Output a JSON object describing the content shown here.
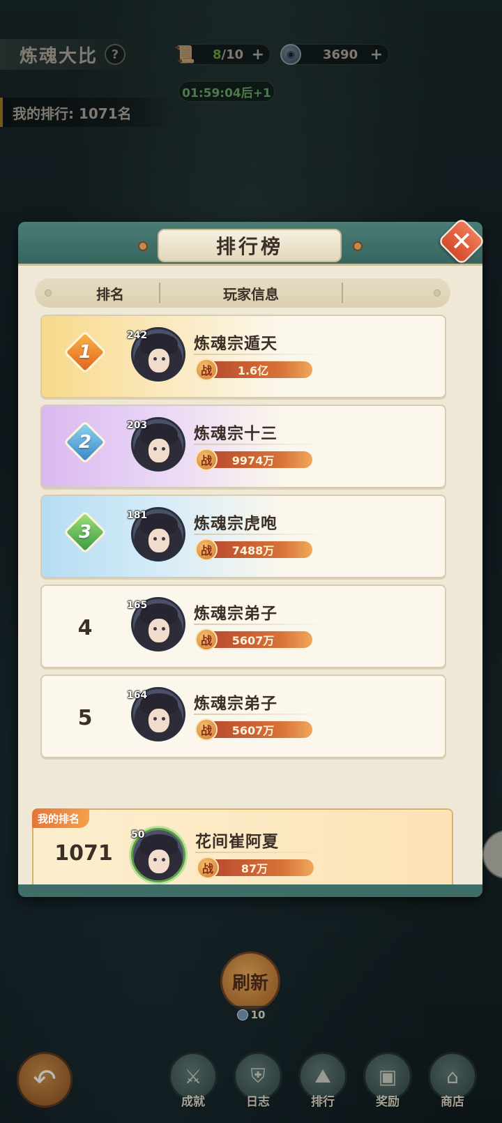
{
  "header": {
    "title": "炼魂大比",
    "help_icon": "question-icon",
    "stamina": {
      "icon": "stamina-icon",
      "current": "8",
      "total": "/10",
      "plus": "+"
    },
    "currency": {
      "icon": "coin-icon",
      "value": "3690",
      "plus": "+"
    },
    "timer": "01:59:04后+1",
    "my_rank_text": "我的排行: 1071名"
  },
  "modal": {
    "title": "排行榜",
    "close_icon": "close-icon",
    "columns": {
      "rank": "排名",
      "player": "玩家信息"
    },
    "rows": [
      {
        "rank": "1",
        "level": "242",
        "name": "炼魂宗遁天",
        "power_label": "战",
        "power": "1.6亿",
        "style": "gold"
      },
      {
        "rank": "2",
        "level": "203",
        "name": "炼魂宗十三",
        "power_label": "战",
        "power": "9974万",
        "style": "purple"
      },
      {
        "rank": "3",
        "level": "181",
        "name": "炼魂宗虎咆",
        "power_label": "战",
        "power": "7488万",
        "style": "blue"
      },
      {
        "rank": "4",
        "level": "165",
        "name": "炼魂宗弟子",
        "power_label": "战",
        "power": "5607万",
        "style": "plain"
      },
      {
        "rank": "5",
        "level": "164",
        "name": "炼魂宗弟子",
        "power_label": "战",
        "power": "5607万",
        "style": "plain"
      }
    ],
    "mine": {
      "tag": "我的排名",
      "rank": "1071",
      "level": "50",
      "name": "花间崔阿夏",
      "power_label": "战",
      "power": "87万"
    }
  },
  "bottom": {
    "refresh_label": "刷新",
    "refresh_cost": "10",
    "back_icon": "back-arrow-icon",
    "nav": [
      {
        "label": "成就",
        "icon": "achievement-icon"
      },
      {
        "label": "日志",
        "icon": "log-icon"
      },
      {
        "label": "排行",
        "icon": "ranking-icon"
      },
      {
        "label": "奖励",
        "icon": "reward-icon"
      },
      {
        "label": "商店",
        "icon": "shop-icon"
      }
    ]
  }
}
